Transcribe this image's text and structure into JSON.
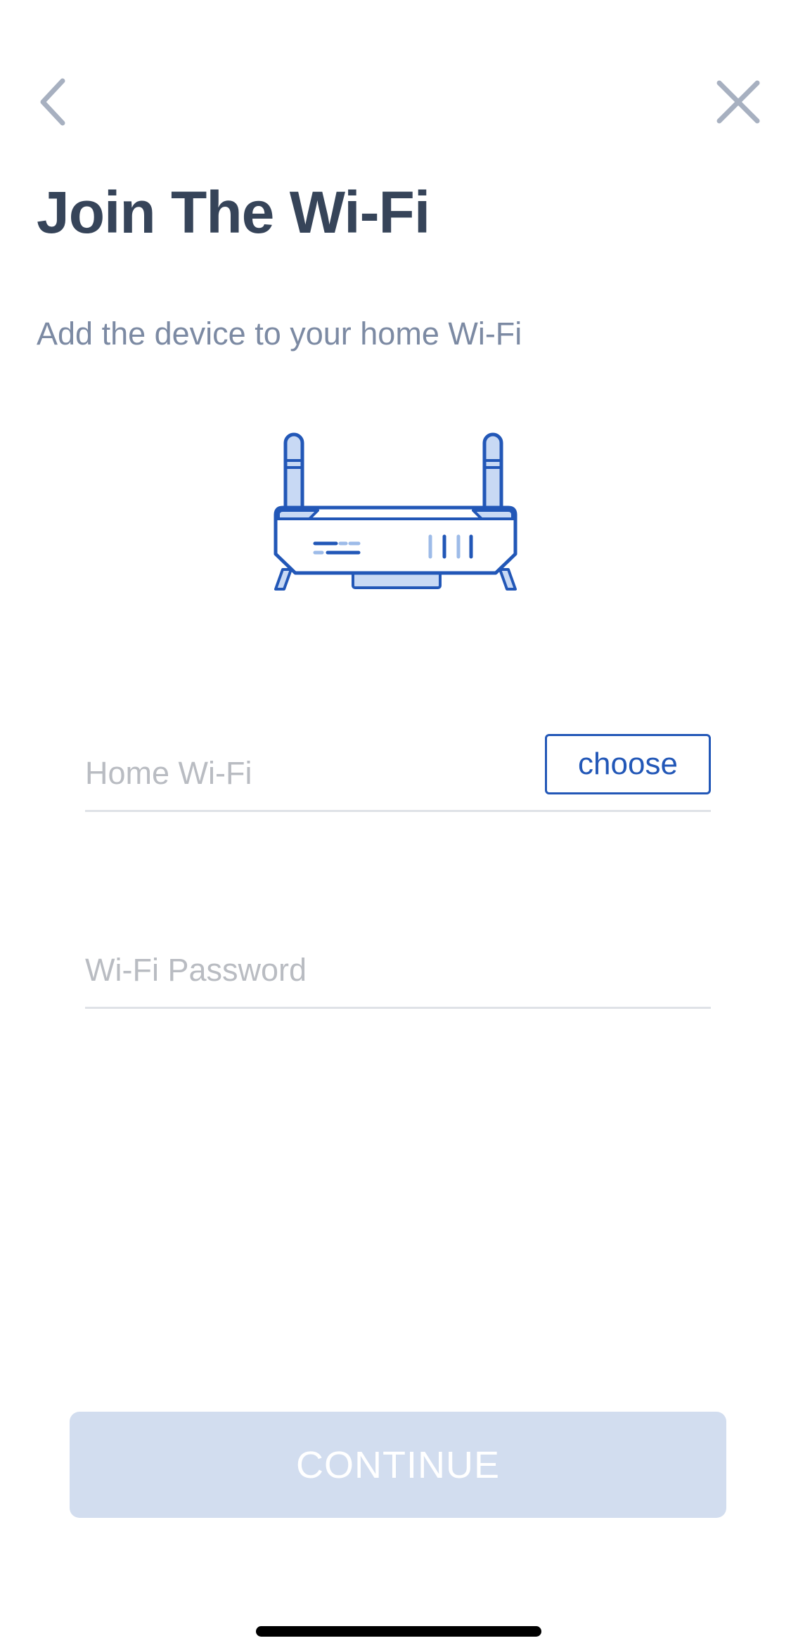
{
  "nav": {
    "back_icon": "chevron-left-icon",
    "close_icon": "close-icon"
  },
  "header": {
    "title": "Join The Wi-Fi",
    "subtitle": "Add the device to your home Wi-Fi"
  },
  "illustration": {
    "icon": "router-icon"
  },
  "form": {
    "wifi_placeholder": "Home Wi-Fi",
    "choose_label": "choose",
    "password_placeholder": "Wi-Fi Password"
  },
  "footer": {
    "continue_label": "CONTINUE"
  },
  "colors": {
    "title": "#364459",
    "subtitle": "#7c8aa3",
    "accent": "#2257b7",
    "accent_light": "#c8d9f4",
    "button_disabled": "#d2ddef",
    "nav_icon": "#a7b0c0"
  }
}
